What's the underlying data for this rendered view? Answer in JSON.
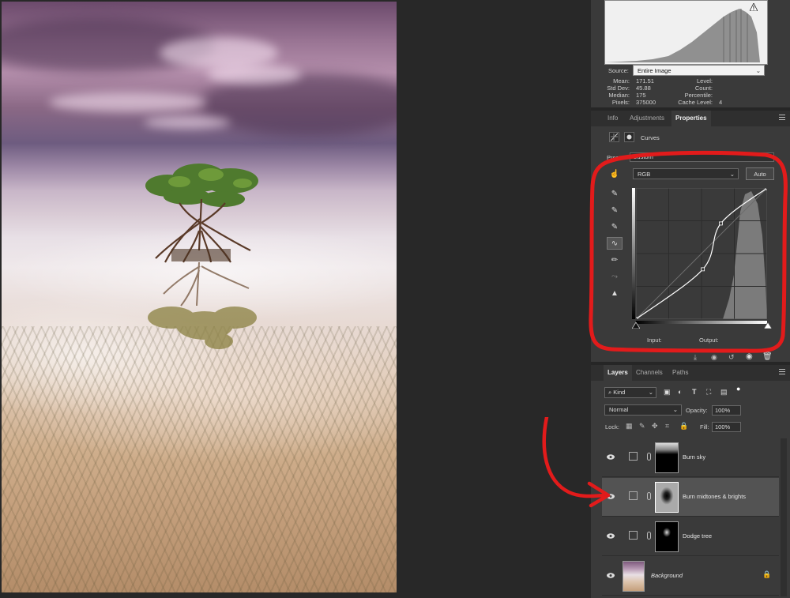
{
  "histogram": {
    "warning_icon": "warning-triangle-icon",
    "source_label": "Source:",
    "source_value": "Entire Image",
    "stats": {
      "mean_label": "Mean:",
      "mean": "171.51",
      "stddev_label": "Std Dev:",
      "stddev": "45.88",
      "median_label": "Median:",
      "median": "175",
      "pixels_label": "Pixels:",
      "pixels": "375000",
      "level_label": "Level:",
      "count_label": "Count:",
      "percentile_label": "Percentile:",
      "cache_label": "Cache Level:",
      "cache": "4"
    }
  },
  "properties_tabs": [
    "Info",
    "Adjustments",
    "Properties"
  ],
  "properties": {
    "adjustment_name": "Curves",
    "preset_label": "Preset:",
    "preset_value": "Custom",
    "channel": "RGB",
    "auto_label": "Auto",
    "input_label": "Input:",
    "output_label": "Output:",
    "curve_points": [
      [
        0,
        0
      ],
      [
        130,
        97
      ],
      [
        165,
        186
      ],
      [
        255,
        255
      ]
    ]
  },
  "layers_tabs": [
    "Layers",
    "Channels",
    "Paths"
  ],
  "layers_panel": {
    "filter_kind": "Kind",
    "blend_mode": "Normal",
    "opacity_label": "Opacity:",
    "opacity": "100%",
    "lock_label": "Lock:",
    "fill_label": "Fill:",
    "fill": "100%",
    "layers": [
      {
        "name": "Burn sky",
        "type": "curves",
        "selected": false
      },
      {
        "name": "Burn midtones & brights",
        "type": "curves",
        "selected": true
      },
      {
        "name": "Dodge tree",
        "type": "curves",
        "selected": false
      },
      {
        "name": "Background",
        "type": "image",
        "selected": false,
        "locked": true
      }
    ]
  },
  "colors": {
    "panel_bg": "#3a3a3a",
    "annotation": "#e21b1b",
    "selected_layer": "#535353"
  }
}
